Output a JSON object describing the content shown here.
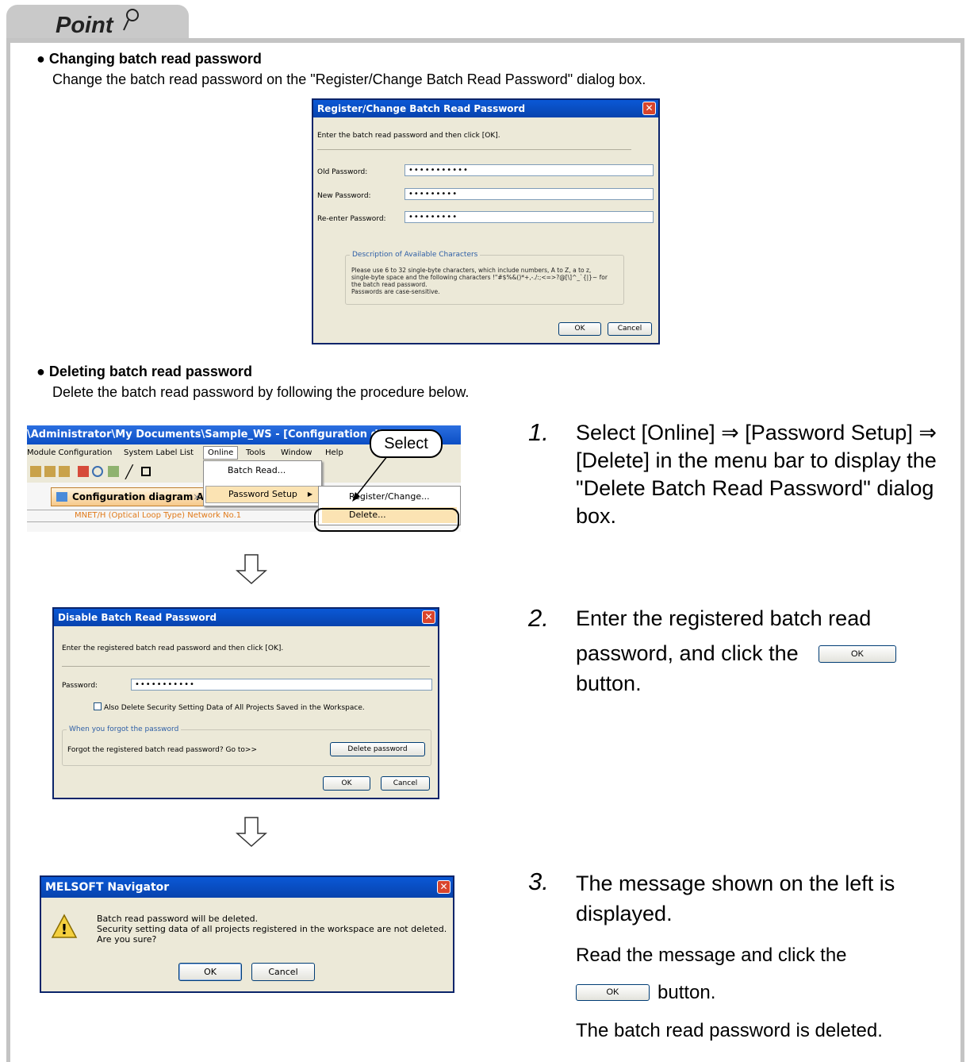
{
  "point": {
    "label": "Point"
  },
  "sections": {
    "change": {
      "title": "Changing batch read password",
      "desc": "Change the batch read password on the \"Register/Change Batch Read Password\" dialog box."
    },
    "delete": {
      "title": "Deleting batch read password",
      "desc": "Delete the batch read password by following the procedure below."
    }
  },
  "reg_dialog": {
    "title": "Register/Change Batch Read Password",
    "instruction": "Enter the batch read password and then click [OK].",
    "old_label": "Old Password:",
    "old_value": "•••••••••••",
    "new_label": "New Password:",
    "new_value": "•••••••••",
    "reenter_label": "Re-enter Password:",
    "reenter_value": "•••••••••",
    "group_label": "Description of Available Characters",
    "desc_line1": "Please use 6 to 32 single-byte characters, which include numbers, A to Z, a to z,",
    "desc_line2": "single-byte space and the following characters !\"#$%&()*+,-./:;<=>?@[\\]^_`{|}~ for",
    "desc_line3": "the batch read password.",
    "desc_line4": "Passwords are case-sensitive.",
    "ok": "OK",
    "cancel": "Cancel"
  },
  "app_window": {
    "title": "\\Administrator\\My Documents\\Sample_WS - [Configuration diagrar",
    "menu": [
      "Module Configuration",
      "System Label List",
      "Online",
      "Tools",
      "Window",
      "Help"
    ],
    "tab": "Configuration diagram A",
    "network_row": "MNET/H (Optical Loop Type) Network No.1",
    "online_menu": [
      "Batch Read...",
      "Password Setup"
    ],
    "submenu": [
      "Register/Change...",
      "Delete..."
    ],
    "callout": "Select"
  },
  "disable_dialog": {
    "title": "Disable Batch Read Password",
    "instruction": "Enter the registered batch read password and then click [OK].",
    "password_label": "Password:",
    "password_value": "•••••••••••",
    "checkbox_label": "Also Delete Security Setting Data of All Projects Saved in the Workspace.",
    "group_label": "When you forgot the password",
    "forgot_text": "Forgot the registered batch read password? Go to>>",
    "delete_btn": "Delete password",
    "ok": "OK",
    "cancel": "Cancel"
  },
  "nav_dialog": {
    "title": "MELSOFT Navigator",
    "line1": "Batch read password will be deleted.",
    "line2": "Security setting data of all projects registered in the workspace are not deleted.",
    "line3": "Are you sure?",
    "ok": "OK",
    "cancel": "Cancel"
  },
  "steps": [
    {
      "num": "1.",
      "text": "Select [Online] ⇒ [Password Setup] ⇒ [Delete] in the menu bar to display the \"Delete Batch Read Password\" dialog box."
    },
    {
      "num": "2.",
      "text_a": "Enter the registered batch read",
      "text_b": "password, and click the",
      "text_c": "button.",
      "btn": "OK"
    },
    {
      "num": "3.",
      "text_a": "The message shown on the left is",
      "text_b": "displayed.",
      "text_c": "Read the message and click the",
      "text_d": "button.",
      "text_e": "The batch read password is deleted.",
      "btn": "OK"
    }
  ]
}
